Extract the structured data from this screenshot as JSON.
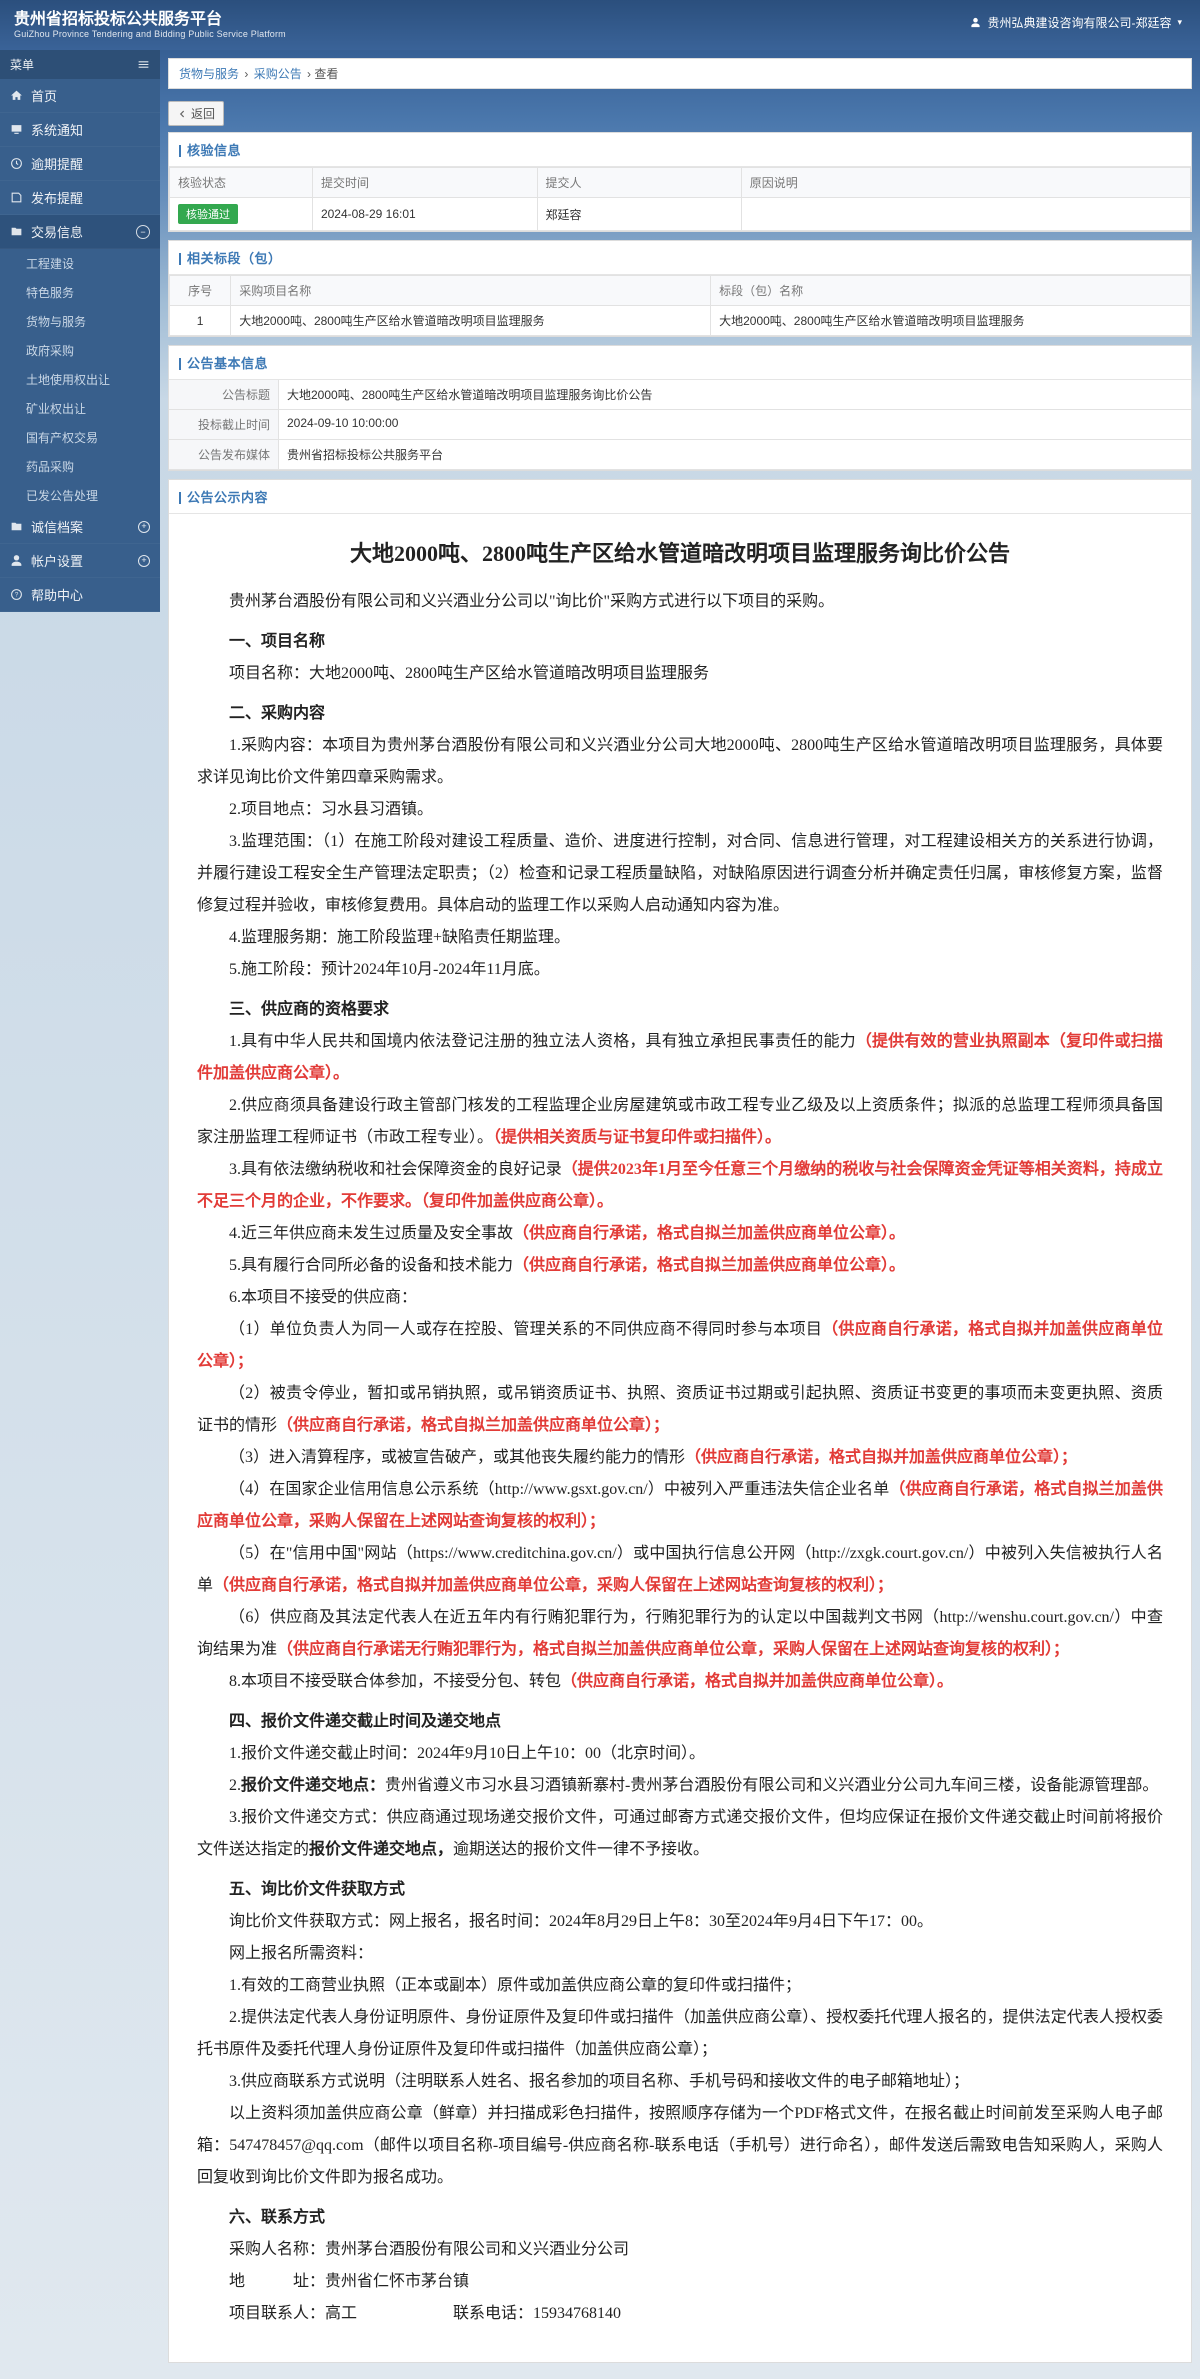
{
  "platform": {
    "title": "贵州省招标投标公共服务平台",
    "subtitle": "GuiZhou Province Tendering and Bidding Public Service Platform",
    "user": "贵州弘典建设咨询有限公司-郑廷容"
  },
  "sidebar": {
    "group": "菜单",
    "items": [
      {
        "icon": "home",
        "label": "首页"
      },
      {
        "icon": "monitor",
        "label": "系统通知"
      },
      {
        "icon": "clock",
        "label": "逾期提醒"
      },
      {
        "icon": "publish",
        "label": "发布提醒"
      },
      {
        "icon": "folder",
        "label": "交易信息",
        "open": true,
        "children": [
          "工程建设",
          "特色服务",
          "货物与服务",
          "政府采购",
          "土地使用权出让",
          "矿业权出让",
          "国有产权交易",
          "药品采购",
          "已发公告处理"
        ]
      },
      {
        "icon": "folder",
        "label": "诚信档案"
      },
      {
        "icon": "user",
        "label": "帐户设置"
      },
      {
        "icon": "help",
        "label": "帮助中心"
      }
    ]
  },
  "breadcrumb": [
    "货物与服务",
    "采购公告",
    "查看"
  ],
  "btn_back": "返回",
  "panels": {
    "verify": {
      "title": "核验信息",
      "cols": [
        "核验状态",
        "提交时间",
        "提交人",
        "原因说明"
      ],
      "row": {
        "status": "核验通过",
        "time": "2024-08-29 16:01",
        "person": "郑廷容",
        "reason": ""
      }
    },
    "bid": {
      "title": "相关标段（包）",
      "cols": [
        "序号",
        "采购项目名称",
        "标段（包）名称"
      ],
      "row": {
        "no": "1",
        "proj": "大地2000吨、2800吨生产区给水管道暗改明项目监理服务",
        "seg": "大地2000吨、2800吨生产区给水管道暗改明项目监理服务"
      }
    },
    "basic": {
      "title": "公告基本信息",
      "rows": [
        {
          "k": "公告标题",
          "v": "大地2000吨、2800吨生产区给水管道暗改明项目监理服务询比价公告"
        },
        {
          "k": "投标截止时间",
          "v": "2024-09-10 10:00:00"
        },
        {
          "k": "公告发布媒体",
          "v": "贵州省招标投标公共服务平台"
        }
      ]
    },
    "content": {
      "title": "公告公示内容"
    }
  },
  "doc": {
    "title": "大地2000吨、2800吨生产区给水管道暗改明项目监理服务询比价公告",
    "intro": "贵州茅台酒股份有限公司和义兴酒业分公司以\"询比价\"采购方式进行以下项目的采购。",
    "s1": "一、项目名称",
    "s1_1": "项目名称：大地2000吨、2800吨生产区给水管道暗改明项目监理服务",
    "s2": "二、采购内容",
    "s2_1": "1.采购内容：本项目为贵州茅台酒股份有限公司和义兴酒业分公司大地2000吨、2800吨生产区给水管道暗改明项目监理服务，具体要求详见询比价文件第四章采购需求。",
    "s2_2": "2.项目地点：习水县习酒镇。",
    "s2_3": "3.监理范围：（1）在施工阶段对建设工程质量、造价、进度进行控制，对合同、信息进行管理，对工程建设相关方的关系进行协调，并履行建设工程安全生产管理法定职责；（2）检查和记录工程质量缺陷，对缺陷原因进行调查分析并确定责任归属，审核修复方案，监督修复过程并验收，审核修复费用。具体启动的监理工作以采购人启动通知内容为准。",
    "s2_4": "4.监理服务期：施工阶段监理+缺陷责任期监理。",
    "s2_5": "5.施工阶段：预计2024年10月-2024年11月底。",
    "s3": "三、供应商的资格要求",
    "s3_1a": "1.具有中华人民共和国境内依法登记注册的独立法人资格，具有独立承担民事责任的能力",
    "s3_1b": "（提供有效的营业执照副本（复印件或扫描件加盖供应商公章）。",
    "s3_2a": "2.供应商须具备建设行政主管部门核发的工程监理企业房屋建筑或市政工程专业乙级及以上资质条件；拟派的总监理工程师须具备国家注册监理工程师证书（市政工程专业）。",
    "s3_2b": "（提供相关资质与证书复印件或扫描件）。",
    "s3_3a": "3.具有依法缴纳税收和社会保障资金的良好记录",
    "s3_3b": "（提供2023年1月至今任意三个月缴纳的税收与社会保障资金凭证等相关资料，持成立不足三个月的企业，不作要求。（复印件加盖供应商公章）。",
    "s3_4a": "4.近三年供应商未发生过质量及安全事故",
    "s3_4b": "（供应商自行承诺，格式自拟兰加盖供应商单位公章）。",
    "s3_5a": "5.具有履行合同所必备的设备和技术能力",
    "s3_5b": "（供应商自行承诺，格式自拟兰加盖供应商单位公章）。",
    "s3_6": "6.本项目不接受的供应商：",
    "s3_6_1a": "（1）单位负责人为同一人或存在控股、管理关系的不同供应商不得同时参与本项目",
    "s3_6_1b": "（供应商自行承诺，格式自拟并加盖供应商单位公章）；",
    "s3_6_2a": "（2）被责令停业，暂扣或吊销执照，或吊销资质证书、执照、资质证书过期或引起执照、资质证书变更的事项而未变更执照、资质证书的情形",
    "s3_6_2b": "（供应商自行承诺，格式自拟兰加盖供应商单位公章）；",
    "s3_6_3a": "（3）进入清算程序，或被宣告破产，或其他丧失履约能力的情形",
    "s3_6_3b": "（供应商自行承诺，格式自拟并加盖供应商单位公章）；",
    "s3_6_4a": "（4）在国家企业信用信息公示系统（http://www.gsxt.gov.cn/）中被列入严重违法失信企业名单",
    "s3_6_4b": "（供应商自行承诺，格式自拟兰加盖供应商单位公章，采购人保留在上述网站查询复核的权利）；",
    "s3_6_5a": "（5）在\"信用中国\"网站（https://www.creditchina.gov.cn/）或中国执行信息公开网（http://zxgk.court.gov.cn/）中被列入失信被执行人名单",
    "s3_6_5b": "（供应商自行承诺，格式自拟并加盖供应商单位公章，采购人保留在上述网站查询复核的权利）；",
    "s3_6_6a": "（6）供应商及其法定代表人在近五年内有行贿犯罪行为，行贿犯罪行为的认定以中国裁判文书网（http://wenshu.court.gov.cn/）中查询结果为准",
    "s3_6_6b": "（供应商自行承诺无行贿犯罪行为，格式自拟兰加盖供应商单位公章，采购人保留在上述网站查询复核的权利）；",
    "s3_8a": "8.本项目不接受联合体参加，不接受分包、转包",
    "s3_8b": "（供应商自行承诺，格式自拟并加盖供应商单位公章）。",
    "s4": "四、报价文件递交截止时间及递交地点",
    "s4_1": "1.报价文件递交截止时间：2024年9月10日上午10：00（北京时间）。",
    "s4_2a": "2.",
    "s4_2b": "报价文件递交地点：",
    "s4_2c": "贵州省遵义市习水县习酒镇新寨村-贵州茅台酒股份有限公司和义兴酒业分公司九车间三楼，设备能源管理部。",
    "s4_3a": "3.报价文件递交方式：供应商通过现场递交报价文件，可通过邮寄方式递交报价文件，但均应保证在报价文件递交截止时间前将报价文件送达指定的",
    "s4_3b": "报价文件递交地点，",
    "s4_3c": "逾期送达的报价文件一律不予接收。",
    "s5": "五、询比价文件获取方式",
    "s5_1": "询比价文件获取方式：网上报名，报名时间：2024年8月29日上午8：30至2024年9月4日下午17：00。",
    "s5_2": "网上报名所需资料：",
    "s5_3": "1.有效的工商营业执照（正本或副本）原件或加盖供应商公章的复印件或扫描件；",
    "s5_4": "2.提供法定代表人身份证明原件、身份证原件及复印件或扫描件（加盖供应商公章）、授权委托代理人报名的，提供法定代表人授权委托书原件及委托代理人身份证原件及复印件或扫描件（加盖供应商公章）；",
    "s5_5": "3.供应商联系方式说明（注明联系人姓名、报名参加的项目名称、手机号码和接收文件的电子邮箱地址）；",
    "s5_6": "以上资料须加盖供应商公章（鲜章）并扫描成彩色扫描件，按照顺序存储为一个PDF格式文件，在报名截止时间前发至采购人电子邮箱：547478457@qq.com（邮件以项目名称-项目编号-供应商名称-联系电话（手机号）进行命名），邮件发送后需致电告知采购人，采购人回复收到询比价文件即为报名成功。",
    "s6": "六、联系方式",
    "s6_1": "采购人名称：贵州茅台酒股份有限公司和义兴酒业分公司",
    "s6_2": "地　　　址：贵州省仁怀市茅台镇",
    "s6_3": "项目联系人：高工　　　　　　联系电话：15934768140"
  }
}
